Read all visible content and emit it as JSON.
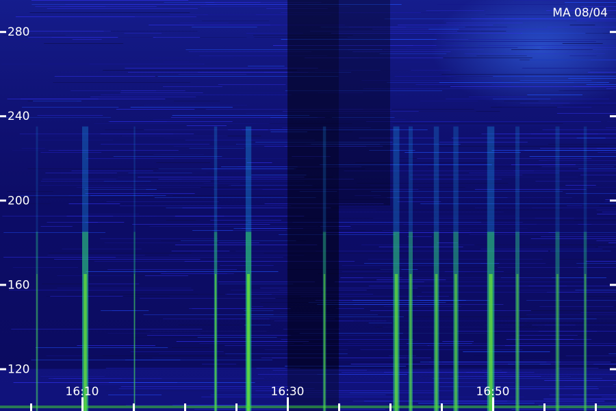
{
  "chart_data": {
    "type": "heatmap",
    "title": "MA 08/04",
    "xlabel": "",
    "ylabel": "",
    "y_ticks": [
      {
        "label": "280",
        "value": 280
      },
      {
        "label": "240",
        "value": 240
      },
      {
        "label": "200",
        "value": 200
      },
      {
        "label": "160",
        "value": 160
      },
      {
        "label": "120",
        "value": 120
      }
    ],
    "x_ticks": [
      {
        "label": "16:10",
        "value": 10
      },
      {
        "label": "16:30",
        "value": 30
      },
      {
        "label": "16:50",
        "value": 50
      }
    ],
    "xlim": [
      2,
      62
    ],
    "ylim": [
      100,
      295
    ],
    "grid": false,
    "colormap": [
      "#000018",
      "#0a0a7a",
      "#1a3cf0",
      "#1aa0f0",
      "#30d060",
      "#80ff20"
    ],
    "bright_bands": [
      {
        "x": 10.3,
        "intensity": 0.9,
        "width": 0.6
      },
      {
        "x": 26.2,
        "intensity": 1.0,
        "width": 0.55
      },
      {
        "x": 23.0,
        "intensity": 0.75,
        "width": 0.3
      },
      {
        "x": 5.6,
        "intensity": 0.5,
        "width": 0.2
      },
      {
        "x": 15.1,
        "intensity": 0.55,
        "width": 0.15
      },
      {
        "x": 33.6,
        "intensity": 0.6,
        "width": 0.3
      },
      {
        "x": 40.6,
        "intensity": 0.85,
        "width": 0.6
      },
      {
        "x": 42.0,
        "intensity": 0.7,
        "width": 0.4
      },
      {
        "x": 44.5,
        "intensity": 0.75,
        "width": 0.5
      },
      {
        "x": 46.4,
        "intensity": 0.7,
        "width": 0.5
      },
      {
        "x": 49.8,
        "intensity": 0.9,
        "width": 0.7
      },
      {
        "x": 52.4,
        "intensity": 0.6,
        "width": 0.4
      },
      {
        "x": 56.3,
        "intensity": 0.55,
        "width": 0.4
      },
      {
        "x": 59.0,
        "intensity": 0.5,
        "width": 0.3
      }
    ]
  }
}
